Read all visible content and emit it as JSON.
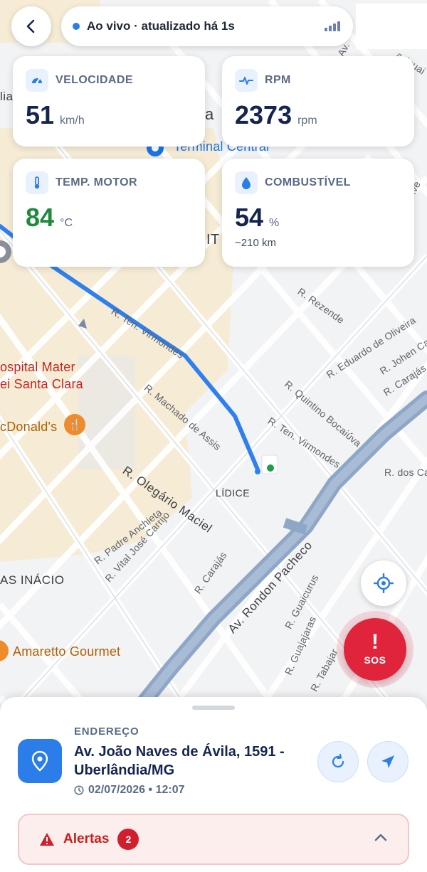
{
  "status": {
    "live_text": "Ao vivo · atualizado há 1s"
  },
  "metrics": {
    "speed": {
      "title": "VELOCIDADE",
      "value": "51",
      "unit": "km/h"
    },
    "rpm": {
      "title": "RPM",
      "value": "2373",
      "unit": "rpm"
    },
    "engine_temp": {
      "title": "TEMP. MOTOR",
      "value": "84",
      "unit": "°C"
    },
    "fuel": {
      "title": "COMBUSTÍVEL",
      "value": "54",
      "unit": "%",
      "range": "~210 km"
    }
  },
  "map": {
    "streets": {
      "rezende": "R. Rezende",
      "eduardo_oliveira": "R. Eduardo de Oliveira",
      "johen_ca": "R. Johen Ca",
      "carajas_right": "R. Carajás",
      "ten_virmondes_1": "R. Ten. Virmondes",
      "quintino": "R. Quintino Bocaiúva",
      "machado": "R. Machado de Assis",
      "ten_virmondes_2": "R. Ten. Virmondes",
      "dos_ca": "R. dos Ca",
      "olegario": "R. Olegário Maciel",
      "padre_anchieta": "R. Padre Anchieta",
      "vital_jose": "R. Vital José Carrijo",
      "carajas_low": "R. Carajás",
      "rondon": "Av. Rondon Pacheco",
      "guaicurus": "R. Guaicurus",
      "guajajaras": "R. Guajajaras",
      "tabajaras": "R. Tabajar",
      "av_top": "Av.",
      "aciguai": "aciguai",
      "taves": "ave"
    },
    "places": {
      "lidice": "LÍDICE",
      "sas_inacio": "AS INÁCIO",
      "hospital_1": "ospital Mater",
      "hospital_2": "ei Santa Clara",
      "mcdonalds": "cDonald's",
      "amaretto": "Amaretto Gourmet",
      "terminal": "Terminal Central",
      "map_a": "a",
      "map_it": "IT",
      "map_lia": "lia"
    },
    "colors": {
      "route": "#2f80ed",
      "avenue": "#8fa7c6",
      "urban_area": "#f6ecd6"
    }
  },
  "sheet": {
    "address_label": "ENDEREÇO",
    "address": "Av. João Naves de Ávila, 1591 - Uberlândia/MG",
    "datetime": "02/07/2026 • 12:07",
    "alerts_label": "Alertas",
    "alerts_count": "2"
  },
  "sos": {
    "mark": "!",
    "label": "SOS"
  }
}
